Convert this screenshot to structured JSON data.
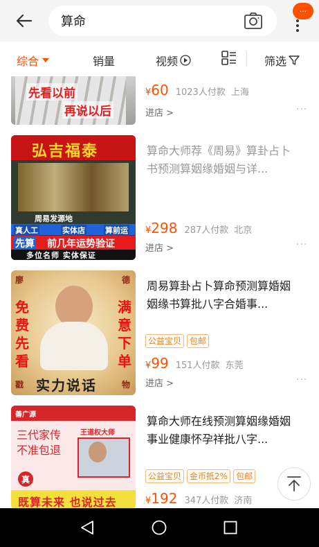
{
  "search": {
    "query": "算命"
  },
  "badge": "···",
  "filters": {
    "comprehensive": "综合",
    "sales": "销量",
    "video": "视频",
    "filter": "筛选"
  },
  "items": [
    {
      "price_symbol": "¥",
      "price": "60",
      "sold": "1023人付款",
      "location": "上海",
      "shop": "进店 >",
      "thumb_text_1": "先看以前",
      "thumb_text_2": "再说以后"
    },
    {
      "title": "算命大师荐《周易》算卦占卜书预测算姻缘婚姻与详...",
      "price_symbol": "¥",
      "price": "298",
      "sold": "287人付款",
      "location": "北京",
      "shop": "进店 >",
      "thumb": {
        "brand": "弘吉福泰",
        "sub": "周易发源地",
        "tag1": "真人工",
        "tag2": "实体店",
        "tag3": "算前运",
        "banner1": "先算",
        "banner2": "前几年运势验证",
        "banner3": "多位名师 实体保证"
      }
    },
    {
      "title": "周易算卦占卜算命预测算婚姻姻缘书算批八字合婚事...",
      "tags": [
        "公益宝贝",
        "包邮"
      ],
      "price_symbol": "¥",
      "price": "99",
      "sold": "151人付款",
      "location": "东莞",
      "shop": "进店 >",
      "thumb": {
        "left": "免费先看",
        "right": "满意下单",
        "bottom": "实力说话",
        "c1": "廖",
        "c2": "德",
        "c3": "戳",
        "c4": "物"
      }
    },
    {
      "title": "算命大师在线预测算姻缘婚姻事业健康怀孕祥批八字...",
      "tags": [
        "公益宝贝",
        "金币抵2%",
        "包邮"
      ],
      "price_symbol": "¥",
      "price": "192",
      "sold": "347人付款",
      "location": "济南",
      "thumb": {
        "corner": "善广源",
        "master": "王道权大师",
        "line1": "三代家传",
        "line2": "不准包退",
        "seal": "真",
        "bottom": "既算未来 也说过去"
      }
    }
  ]
}
